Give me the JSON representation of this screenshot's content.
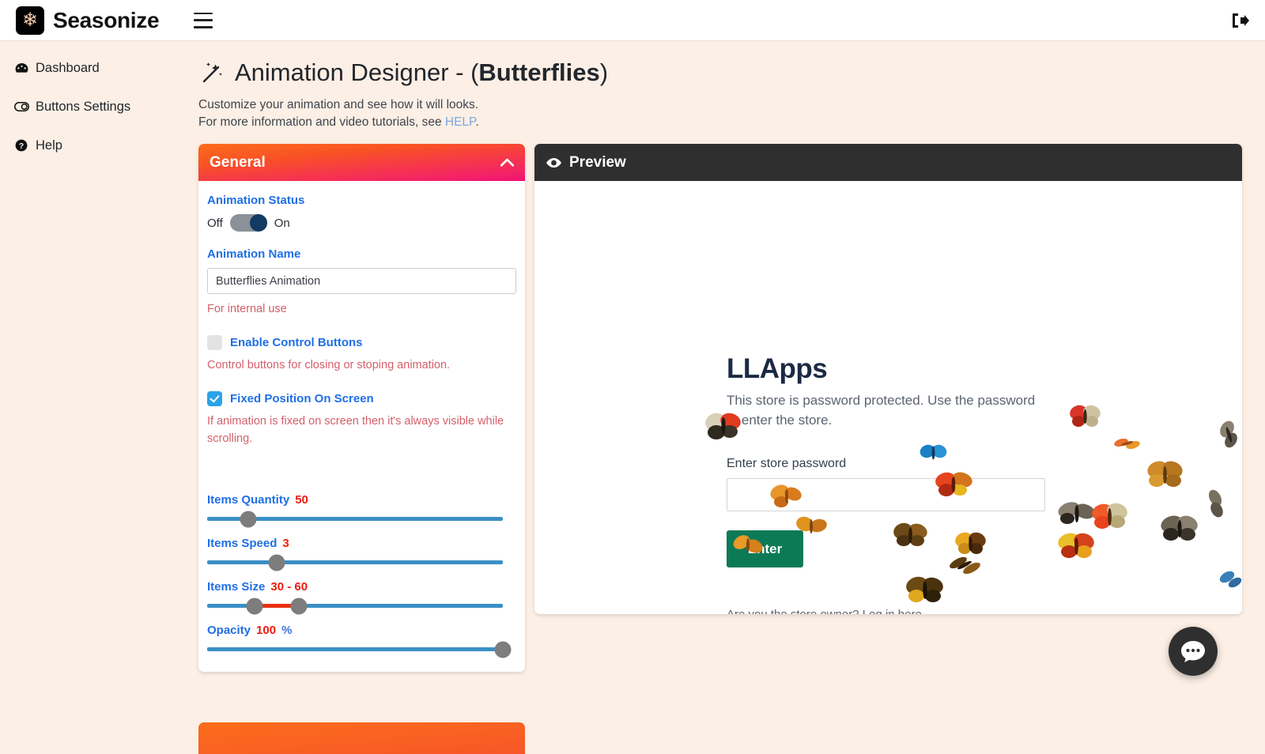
{
  "topbar": {
    "brand_name": "Seasonize",
    "logo_icon": "snowflake-icon",
    "menu_icon": "hamburger-menu-icon",
    "logout_icon": "logout-icon"
  },
  "sidebar": {
    "items": [
      {
        "label": "Dashboard",
        "icon": "tachometer-icon"
      },
      {
        "label": "Buttons Settings",
        "icon": "toggle-icon"
      },
      {
        "label": "Help",
        "icon": "question-circle-icon"
      }
    ]
  },
  "page": {
    "title_prefix": "Animation Designer - ( ",
    "title_bold": "Butterflies",
    "title_suffix": " )",
    "wand_icon": "magic-wand-icon",
    "sub_line1": "Customize your animation and see how it will looks.",
    "sub_line2_before": "For more information and video tutorials, see ",
    "sub_link": "HELP",
    "sub_line2_after": "."
  },
  "general_panel": {
    "title": "General",
    "collapse_icon": "chevron-up-icon",
    "animation_status_label": "Animation Status",
    "toggle_off_label": "Off",
    "toggle_on_label": "On",
    "toggle_value": "On",
    "animation_name_label": "Animation Name",
    "animation_name_value": "Butterflies Animation",
    "animation_name_hint": "For internal use",
    "enable_control_buttons_label": "Enable Control Buttons",
    "enable_control_buttons_checked": "false",
    "enable_control_buttons_hint": "Control buttons for closing or stoping animation.",
    "fixed_position_label": "Fixed Position On Screen",
    "fixed_position_checked": "true",
    "fixed_position_hint": "If animation is fixed on screen then it's always visible while scrolling.",
    "sliders": [
      {
        "label": "Items Quantity",
        "value": "50",
        "unit": ""
      },
      {
        "label": "Items Speed",
        "value": "3",
        "unit": ""
      },
      {
        "label": "Items Size",
        "value": "30 - 60",
        "unit": ""
      },
      {
        "label": "Opacity",
        "value": "100",
        "unit": "%"
      }
    ]
  },
  "preview_panel": {
    "title": "Preview",
    "eye_icon": "eye-icon",
    "store_title": "LLApps",
    "store_desc": "This store is password protected. Use the password to enter the store.",
    "store_field_label": "Enter store password",
    "store_input_value": "",
    "store_button_label": "Enter",
    "store_footer": "Are you the store owner? Log in here"
  },
  "chat": {
    "icon": "chat-bubble-icon"
  },
  "colors": {
    "page_bg": "#fcefe5",
    "panel_gradient_start": "#fb6d1b",
    "panel_gradient_end": "#ee0f72",
    "preview_header": "#2f2f2f",
    "label_blue": "#1f6fe5",
    "value_red": "#f01c0f",
    "hint_red": "#d4606a",
    "slider_track": "#3a8fc4",
    "enter_button": "#0d7a56"
  }
}
